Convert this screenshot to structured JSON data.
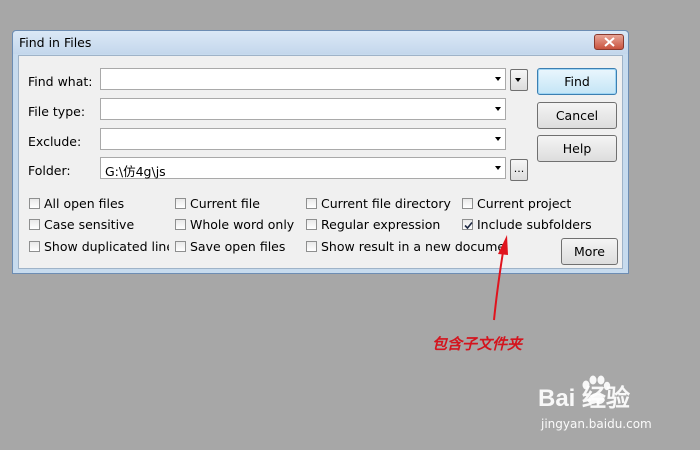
{
  "dialog": {
    "title": "Find in Files",
    "fields": {
      "find_what": {
        "label": "Find what:",
        "value": ""
      },
      "file_type": {
        "label": "File type:",
        "value": ""
      },
      "exclude": {
        "label": "Exclude:",
        "value": ""
      },
      "folder": {
        "label": "Folder:",
        "value": "G:\\仿4g\\js",
        "browse_label": "..."
      }
    },
    "buttons": {
      "find": "Find",
      "cancel": "Cancel",
      "help": "Help",
      "more": "More"
    },
    "options": {
      "all_open_files": {
        "label": "All open files",
        "checked": false
      },
      "current_file": {
        "label": "Current file",
        "checked": false
      },
      "current_file_directory": {
        "label": "Current file directory",
        "checked": false
      },
      "current_project": {
        "label": "Current project",
        "checked": false
      },
      "case_sensitive": {
        "label": "Case sensitive",
        "checked": false
      },
      "whole_word_only": {
        "label": "Whole word only",
        "checked": false
      },
      "regular_expression": {
        "label": "Regular expression",
        "checked": false
      },
      "include_subfolders": {
        "label": "Include subfolders",
        "checked": true
      },
      "show_duplicated_lines": {
        "label": "Show duplicated lines",
        "checked": false
      },
      "save_open_files": {
        "label": "Save open files",
        "checked": false
      },
      "show_result_new_document": {
        "label": "Show result in a new document",
        "checked": false
      }
    }
  },
  "annotation": {
    "text": "包含子文件夹",
    "color": "#d4141e"
  },
  "watermark": {
    "brand": "Bai  经验",
    "url": "jingyan.baidu.com"
  }
}
